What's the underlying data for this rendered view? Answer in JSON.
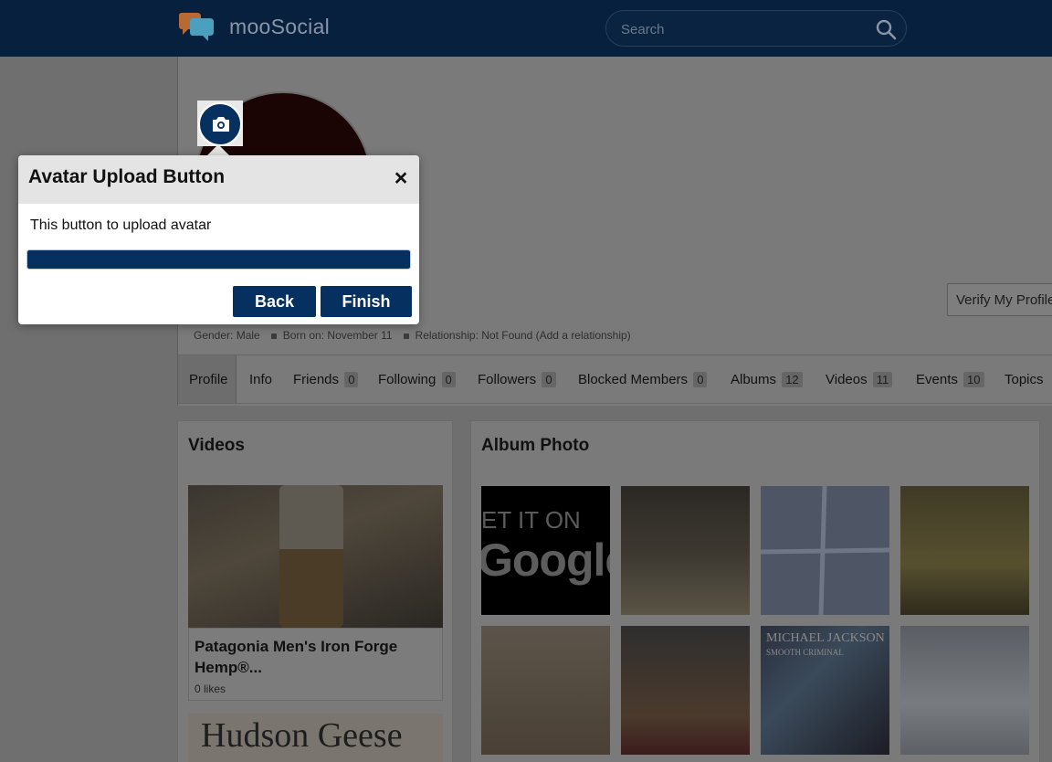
{
  "header": {
    "app_name": "mooSocial",
    "search_placeholder": "Search"
  },
  "profile": {
    "verify_label": "Verify My Profile",
    "gender": "Gender: Male",
    "born": "Born on: November 11",
    "relationship": "Relationship: Not Found (Add a relationship)"
  },
  "tabs": [
    {
      "label": "Profile"
    },
    {
      "label": "Info"
    },
    {
      "label": "Friends",
      "count": "0"
    },
    {
      "label": "Following",
      "count": "0"
    },
    {
      "label": "Followers",
      "count": "0"
    },
    {
      "label": "Blocked Members",
      "count": "0"
    },
    {
      "label": "Albums",
      "count": "12"
    },
    {
      "label": "Videos",
      "count": "11"
    },
    {
      "label": "Events",
      "count": "10"
    },
    {
      "label": "Topics"
    }
  ],
  "videos": {
    "title": "Videos",
    "item_title": "Patagonia Men's Iron Forge Hemp®...",
    "item_likes": "0 likes",
    "next_item_text": "Hudson Geese"
  },
  "album": {
    "title": "Album Photo",
    "photo1_line1": "ET IT ON",
    "photo1_line2": "Google",
    "photo7_text": "MICHAEL JACKSON",
    "photo7_subtext": "SMOOTH CRIMINAL"
  },
  "dialog": {
    "title": "Avatar Upload Button",
    "close": "×",
    "body": "This button to upload avatar",
    "progress": 1.0,
    "back_label": "Back",
    "finish_label": "Finish"
  },
  "colors": {
    "header_bg": "#06203d",
    "accent": "#06305f"
  }
}
